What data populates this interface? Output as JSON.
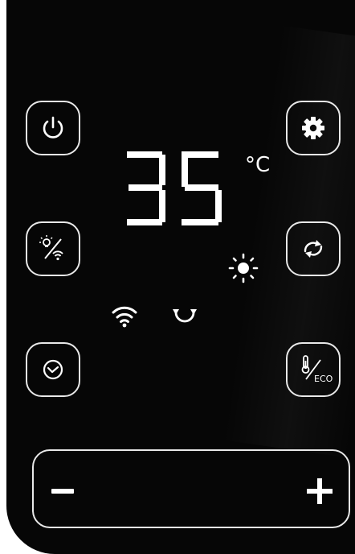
{
  "display": {
    "temperature": "35",
    "unit": "°C"
  },
  "buttons": {
    "power": {
      "icon": "power-icon"
    },
    "settings": {
      "icon": "gear-icon"
    },
    "light_wifi": {
      "icon": "light-wifi-toggle-icon"
    },
    "mode": {
      "icon": "cycle-mode-icon"
    },
    "timer": {
      "icon": "clock-icon"
    },
    "eco": {
      "icon": "thermometer-eco-icon",
      "label": "ECO"
    }
  },
  "indicators": [
    "wifi-icon",
    "cycle-icon",
    "sun-icon"
  ],
  "control_bar": {
    "decrease": "minus-icon",
    "increase": "plus-icon"
  },
  "colors": {
    "background": "#060606",
    "foreground": "#ffffff"
  }
}
